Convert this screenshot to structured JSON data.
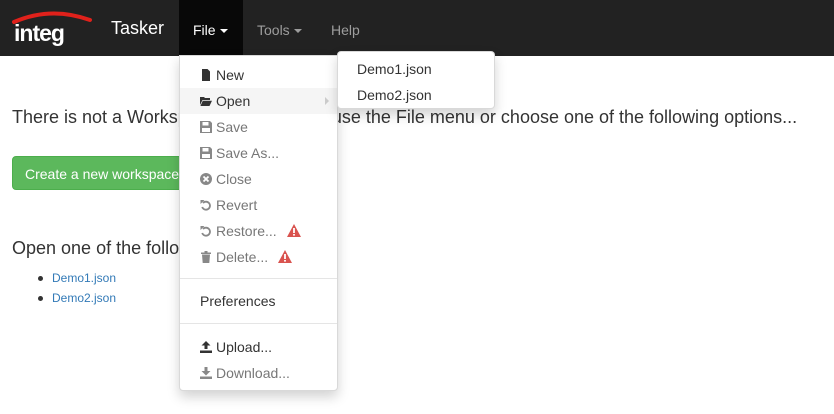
{
  "navbar": {
    "logo_text": "integ",
    "brand": "Tasker",
    "menus": [
      {
        "label": "File"
      },
      {
        "label": "Tools"
      },
      {
        "label": "Help"
      }
    ]
  },
  "page": {
    "message": "There is not a Workspace open. Please use the File menu or choose one of the following options...",
    "create_button": "Create a new workspace",
    "open_heading": "Open one of the following workspaces:",
    "recent_files": [
      "Demo1.json",
      "Demo2.json"
    ]
  },
  "file_menu": {
    "items": [
      {
        "label": "New",
        "icon": "file-icon",
        "disabled": false
      },
      {
        "label": "Open",
        "icon": "folder-open-icon",
        "disabled": false,
        "submenu": true
      },
      {
        "label": "Save",
        "icon": "save-icon",
        "disabled": true
      },
      {
        "label": "Save As...",
        "icon": "save-icon",
        "disabled": true
      },
      {
        "label": "Close",
        "icon": "close-circle-icon",
        "disabled": true
      },
      {
        "label": "Revert",
        "icon": "revert-icon",
        "disabled": true
      },
      {
        "label": "Restore...",
        "icon": "revert-icon",
        "disabled": true,
        "warning": true
      },
      {
        "label": "Delete...",
        "icon": "trash-icon",
        "disabled": true,
        "warning": true
      },
      {
        "label": "Preferences",
        "disabled": false
      },
      {
        "label": "Upload...",
        "icon": "upload-icon",
        "disabled": false
      },
      {
        "label": "Download...",
        "icon": "download-icon",
        "disabled": true
      }
    ]
  },
  "open_submenu": {
    "items": [
      "Demo1.json",
      "Demo2.json"
    ]
  },
  "colors": {
    "navbar_bg": "#222222",
    "active_nav_bg": "#080808",
    "success": "#5cb85c",
    "link": "#337ab7",
    "warning": "#d9534f",
    "logo_red": "#e0211b"
  }
}
